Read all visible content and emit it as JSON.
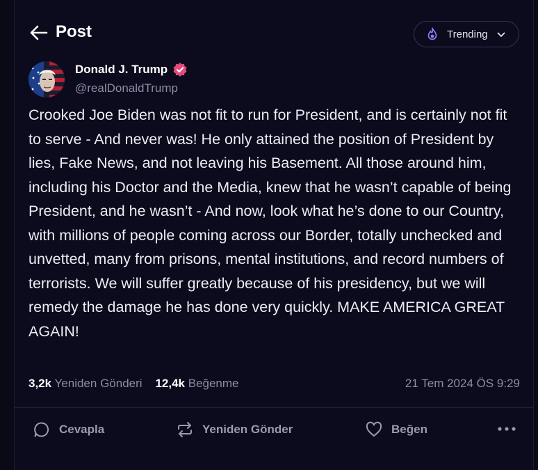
{
  "header": {
    "title": "Post",
    "trending_label": "Trending"
  },
  "author": {
    "name": "Donald J. Trump",
    "handle": "@realDonaldTrump"
  },
  "post": {
    "text": "Crooked Joe Biden was not fit to run for President, and is certainly not fit to serve - And never was! He only attained the position of President by lies, Fake News, and not leaving his Basement. All those around him, including his Doctor and the Media, knew that he wasn’t capable of being President, and he wasn’t - And now, look what he’s done to our Country, with millions of people coming across our Border, totally unchecked and unvetted, many from prisons, mental institutions, and record numbers of terrorists. We will suffer greatly because of his presidency, but we will remedy the damage he has done very quickly. MAKE AMERICA GREAT AGAIN!",
    "timestamp": "21 Tem 2024 ÖS 9:29"
  },
  "stats": {
    "reposts_count": "3,2k",
    "reposts_label": "Yeniden Gönderi",
    "likes_count": "12,4k",
    "likes_label": "Beğenme"
  },
  "actions": {
    "reply_label": "Cevapla",
    "repost_label": "Yeniden Gönder",
    "like_label": "Beğen"
  },
  "colors": {
    "background": "#0c0b1d",
    "text_primary": "#ffffff",
    "text_secondary": "#8c8ca6",
    "accent": "#8b7cf6",
    "verified_badge": "#e44a7c"
  },
  "icons": {
    "back": "arrow-left-icon",
    "trending": "flame-icon",
    "chevron": "chevron-down-icon",
    "verified": "verified-badge-icon",
    "reply": "speech-bubble-icon",
    "repost": "repost-arrows-icon",
    "like": "heart-icon",
    "more": "ellipsis-icon"
  }
}
